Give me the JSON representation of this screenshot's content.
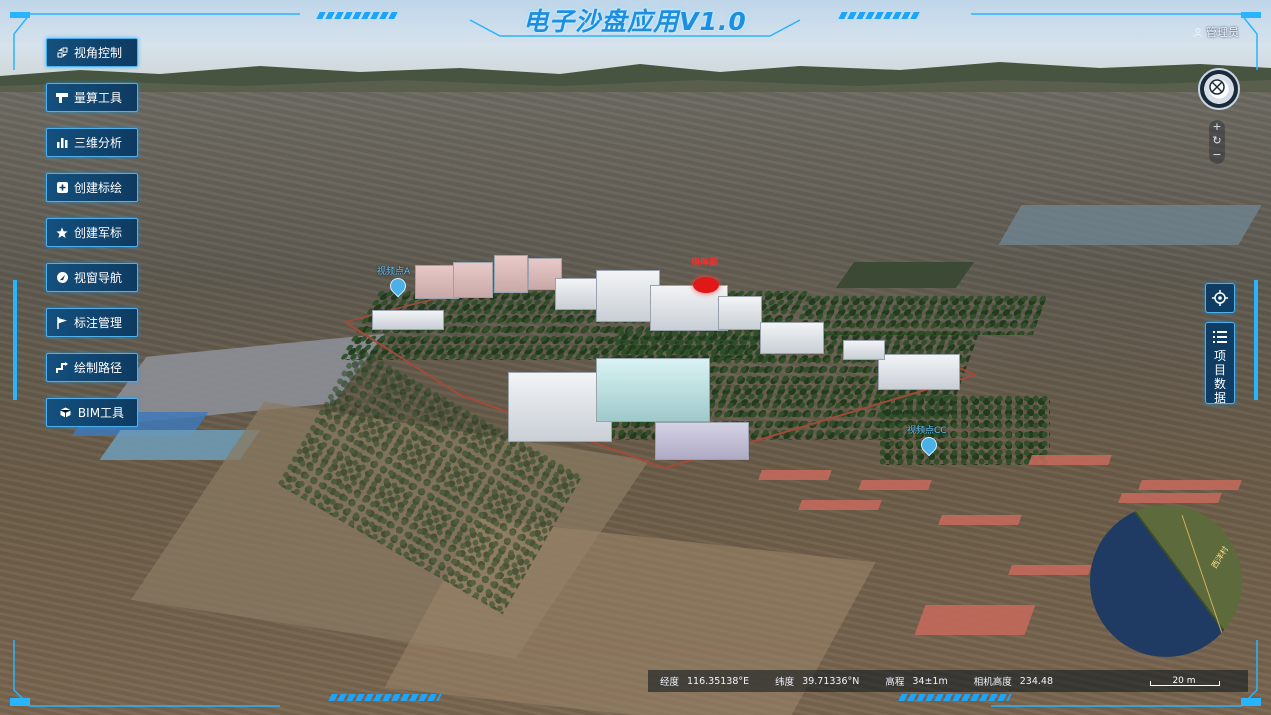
{
  "header": {
    "title": "电子沙盘应用V1.0",
    "user_label": "管理员"
  },
  "menu": {
    "items": [
      {
        "label": "视角控制",
        "icon": "view-control-icon"
      },
      {
        "label": "量算工具",
        "icon": "measure-tool-icon"
      },
      {
        "label": "三维分析",
        "icon": "bar-chart-icon"
      },
      {
        "label": "创建标绘",
        "icon": "plus-square-icon"
      },
      {
        "label": "创建军标",
        "icon": "star-icon"
      },
      {
        "label": "视窗导航",
        "icon": "navigation-icon"
      },
      {
        "label": "标注管理",
        "icon": "flag-icon"
      },
      {
        "label": "绘制路径",
        "icon": "path-icon"
      },
      {
        "label": "BIM工具",
        "icon": "cube-icon"
      }
    ]
  },
  "right_panel": {
    "compass_icon": "compass-icon",
    "zoom_in": "+",
    "reset": "↻",
    "zoom_out": "−",
    "project_data_label": "项目数据"
  },
  "status_bar": {
    "longitude_label": "经度",
    "longitude_value": "116.35138°E",
    "latitude_label": "纬度",
    "latitude_value": "39.71336°N",
    "elevation_label": "高程",
    "elevation_value": "34±1m",
    "camera_height_label": "相机高度",
    "camera_height_value": "234.48",
    "scale_label": "20 m"
  },
  "markers": {
    "monitor_a": "视频点A",
    "monitor_cc": "视频点CC",
    "hq_label": "指挥部"
  },
  "minimap": {
    "road_label": "西洋村"
  },
  "colors": {
    "accent": "#1aa6ff",
    "title": "#1c8fe0",
    "button_bg": "#0f3c63",
    "hq_marker": "#e01818"
  }
}
